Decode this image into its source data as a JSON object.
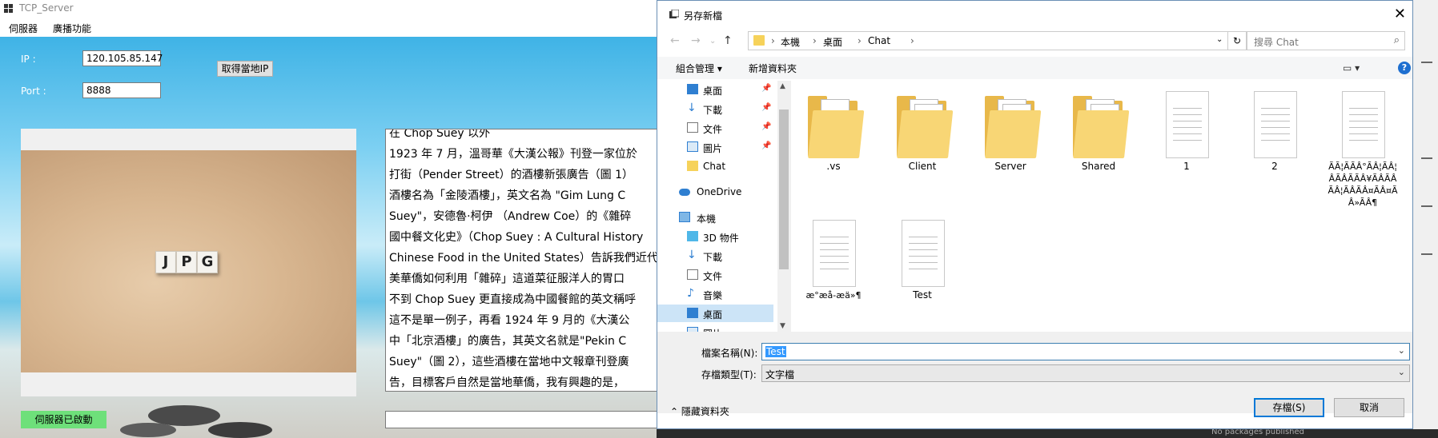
{
  "server_window": {
    "title": "TCP_Server",
    "menu": [
      "伺服器",
      "廣播功能"
    ],
    "ip_label": "IP :",
    "ip_value": "120.105.85.147",
    "port_label": "Port :",
    "port_value": "8888",
    "get_local_ip_button": "取得當地IP",
    "picture_caption": "JPG",
    "text_lines": [
      "在 Chop Suey 以外",
      "1923 年 7 月，溫哥華《大漢公報》刊登一家位於",
      "打街（Pender Street）的酒樓新張廣告（圖 1）",
      "酒樓名為「金陵酒樓」，英文名為 \"Gim Lung C",
      "Suey\"，安德魯·柯伊 （Andrew Coe）的《雜碎",
      "國中餐文化史》（Chop Suey : A Cultural History",
      "Chinese Food in the United States）告訴我們近代",
      "美華僑如何利用「雜碎」這道菜征服洋人的胃口",
      "不到 Chop Suey 更直接成為中國餐館的英文稱呼",
      "這不是單一例子，再看 1924 年 9 月的《大漢公",
      "中「北京酒樓」的廣告，其英文名就是\"Pekin C",
      "Suey\"（圖 2），這些酒樓在當地中文報章刊登廣",
      "告，目標客戶自然是當地華僑，我有興趣的是，"
    ],
    "status": "伺服器已啟動",
    "message_input": ""
  },
  "save_dialog": {
    "title": "另存新檔",
    "breadcrumb": [
      "本機",
      "桌面",
      "Chat"
    ],
    "search_placeholder": "搜尋 Chat",
    "toolbar": {
      "organize": "組合管理 ▾",
      "new_folder": "新增資料夾"
    },
    "nav_items": [
      {
        "label": "桌面",
        "icon": "desktop-icon",
        "pinned": true
      },
      {
        "label": "下載",
        "icon": "download-icon",
        "pinned": true
      },
      {
        "label": "文件",
        "icon": "document-icon",
        "pinned": true
      },
      {
        "label": "圖片",
        "icon": "picture-icon",
        "pinned": true
      },
      {
        "label": "Chat",
        "icon": "folder-icon",
        "pinned": false
      },
      {
        "label": "OneDrive",
        "icon": "cloud-icon",
        "pinned": false
      },
      {
        "label": "本機",
        "icon": "computer-icon",
        "pinned": false
      },
      {
        "label": "3D 物件",
        "icon": "cube-icon",
        "pinned": false
      },
      {
        "label": "下載",
        "icon": "download-icon",
        "pinned": false
      },
      {
        "label": "文件",
        "icon": "document-icon",
        "pinned": false
      },
      {
        "label": "音樂",
        "icon": "music-icon",
        "pinned": false
      },
      {
        "label": "桌面",
        "icon": "desktop-icon",
        "pinned": false
      },
      {
        "label": "圖片",
        "icon": "picture-icon",
        "pinned": false
      }
    ],
    "files": [
      {
        "name": ".vs",
        "type": "folder"
      },
      {
        "name": "Client",
        "type": "folder"
      },
      {
        "name": "Server",
        "type": "folder"
      },
      {
        "name": "Shared",
        "type": "folder"
      },
      {
        "name": "1",
        "type": "text"
      },
      {
        "name": "2",
        "type": "text"
      },
      {
        "name": "Ã­Ã¦ÃÃÂ°ÃÂ¦ÃÂ¦ÂÃÂÃÃÂ¥ÃÂ­ÃÂÃÂ¦ÃÂÃÂ¤ÃÂ¤ÃÂ»ÃÂ¶",
        "type": "text"
      },
      {
        "name": "æ°æå-æä»¶",
        "type": "text"
      },
      {
        "name": "Test",
        "type": "text"
      }
    ],
    "filename_label": "檔案名稱(N):",
    "filename_value": "Test",
    "filetype_label": "存檔類型(T):",
    "filetype_value": "文字檔",
    "hide_folders": "隱藏資料夾",
    "save_button": "存檔(S)",
    "cancel_button": "取消"
  },
  "background_hint": "No packages published",
  "colors": {
    "status_green": "#6ee07a",
    "selection_blue": "#3399ff",
    "accent": "#0078d7"
  }
}
